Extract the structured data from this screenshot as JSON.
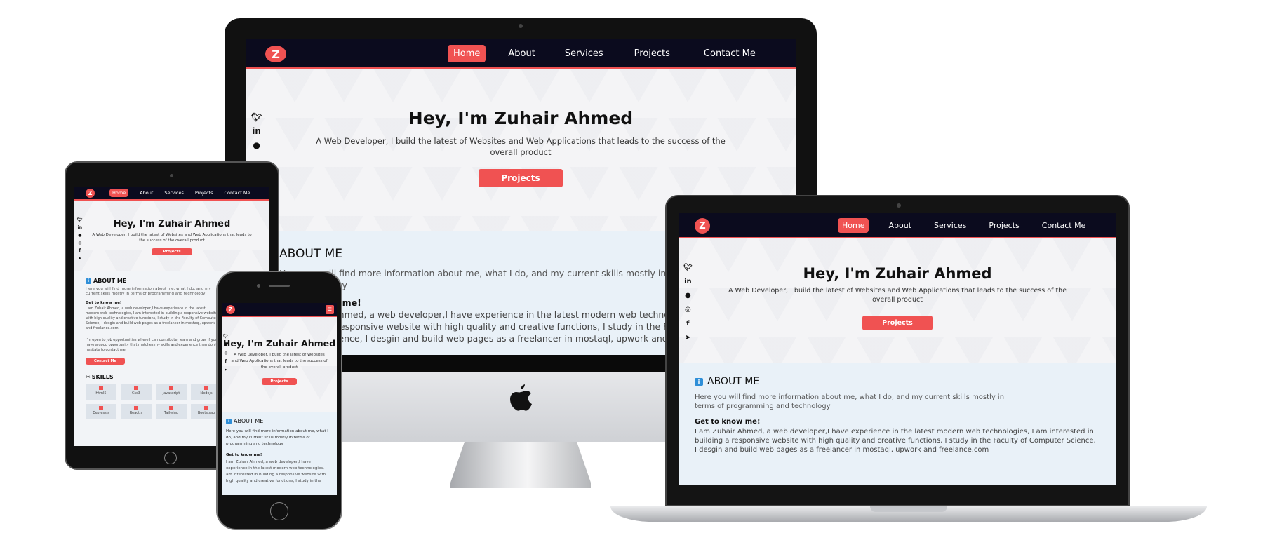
{
  "site": {
    "logo_letter": "Z",
    "nav": {
      "home": "Home",
      "about": "About",
      "services": "Services",
      "projects": "Projects",
      "contact": "Contact Me"
    },
    "hero": {
      "title": "Hey, I'm Zuhair Ahmed",
      "subtitle": "A Web Developer, I build the latest of Websites and Web Applications that leads to the success of the overall product",
      "button": "Projects"
    },
    "about": {
      "heading": "ABOUT ME",
      "lead": "Here you will find more information about me, what I do, and my current skills mostly in terms of programming and technology",
      "know_heading": "Get to know me!",
      "know_body": "I am Zuhair Ahmed, a web developer,I have experience in the latest modern web technologies, I am interested in building a responsive website with high quality and creative functions, I study in the Faculty of Computer Science, I desgin and build web pages as a freelancer in mostaql, upwork and freelance.com",
      "open_body": "I'm open to Job opportunities where I can contribute, learn and grow. If you have a good opportunity that matches my skills and experience then don't hesitate to contact me.",
      "contact_button": "Contact Me"
    },
    "skills": {
      "heading": "SKILLS",
      "items": [
        "Html5",
        "Css3",
        "Javascript",
        "NodeJs",
        "ExpressJs",
        "ReactJs",
        "Tailwind",
        "Bootstrap"
      ]
    },
    "social_icons": [
      "twitter-icon",
      "linkedin-icon",
      "github-icon",
      "whatsapp-icon",
      "facebook-icon",
      "telegram-icon"
    ],
    "colors": {
      "accent": "#f05252",
      "nav_bg": "#0b0b1e",
      "about_bg": "#e9f1f8",
      "info_blue": "#2f8fd8"
    }
  },
  "monitor_about_visible": {
    "lead_line1": "Here you will find more information about me, what I do, and my current skills mostly in terms of programming",
    "lead_line2": "and technology",
    "know_heading": "Get to know me!",
    "body_line1": "I am Zuhair Ahmed, a web developer,I have experience in the latest modern web technologies, I am interested",
    "body_line2": "in building a responsive website with high quality and creative functions, I study in the Faculty of",
    "body_line3": "Computer Science, I desgin and build web pages as a freelancer in mostaql, upwork and freelance.com"
  }
}
